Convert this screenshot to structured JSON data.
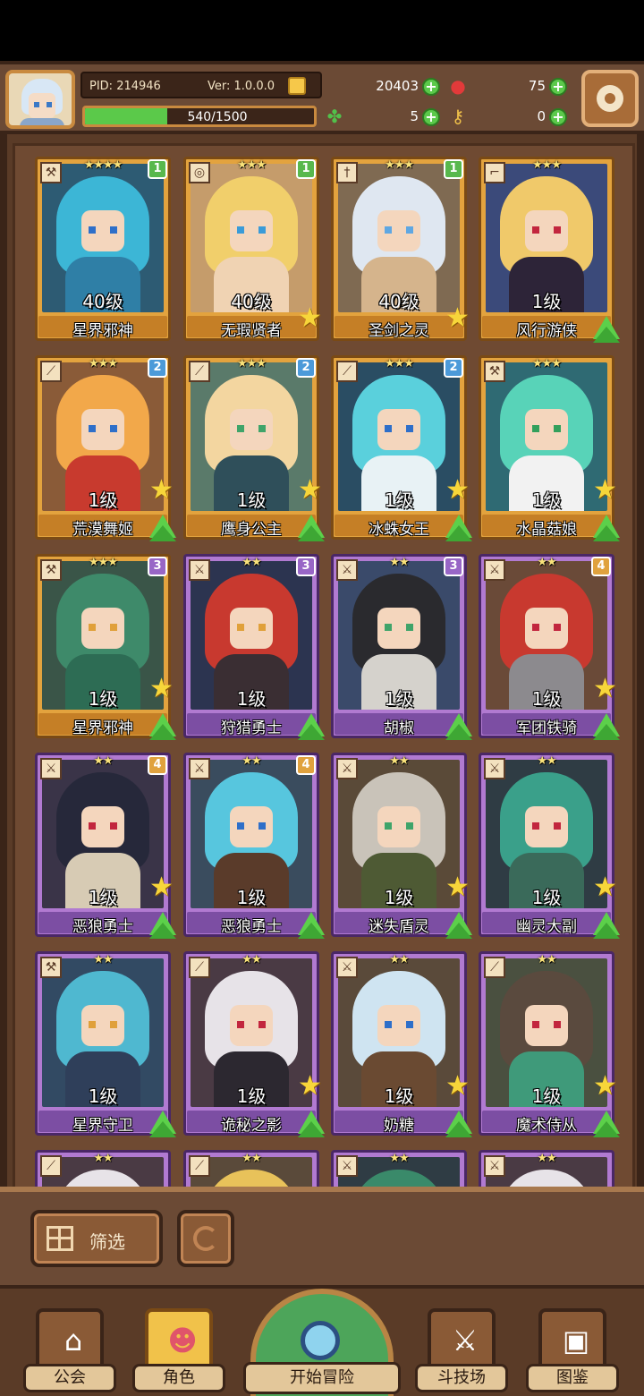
{
  "player": {
    "pid": "PID: 214946",
    "version": "Ver: 1.0.0.0",
    "xp_text": "540/1500",
    "xp_progress": 0.36
  },
  "resources": {
    "gold": "20403",
    "gems": "75",
    "clover": "5",
    "keys": "0"
  },
  "cards": [
    {
      "level": "40级",
      "name": "星界邪神",
      "stars": "★★★★",
      "rarity": "gold",
      "badge": "1",
      "badge_color": "green",
      "weapon": "wrench",
      "star_icon": false,
      "up": false,
      "hair": "#3cb6d6",
      "torso": "#2f7fa6",
      "eye": "#2e6fc9",
      "bg": "#2d5b73"
    },
    {
      "level": "40级",
      "name": "无瑕贤者",
      "stars": "★★★",
      "rarity": "gold",
      "badge": "1",
      "badge_color": "green",
      "weapon": "orb",
      "star_icon": true,
      "up": false,
      "hair": "#f1cf6b",
      "torso": "#f0d3b3",
      "eye": "#3a9bd8",
      "bg": "#c59c6b"
    },
    {
      "level": "40级",
      "name": "圣剑之灵",
      "stars": "★★★",
      "rarity": "gold",
      "badge": "1",
      "badge_color": "green",
      "weapon": "sword",
      "star_icon": true,
      "up": false,
      "hair": "#dfe7f1",
      "torso": "#d5b48c",
      "eye": "#5fa7e2",
      "bg": "#7f6a52"
    },
    {
      "level": "1级",
      "name": "风行游侠",
      "stars": "★★★",
      "rarity": "gold",
      "badge": "",
      "badge_color": "",
      "weapon": "gun",
      "star_icon": false,
      "up": true,
      "hair": "#f0c96a",
      "torso": "#2d2438",
      "eye": "#c2263e",
      "bg": "#3b4a7a"
    },
    {
      "level": "1级",
      "name": "荒漠舞姬",
      "stars": "★★★",
      "rarity": "gold",
      "badge": "2",
      "badge_color": "blue",
      "weapon": "blade",
      "star_icon": true,
      "up": true,
      "hair": "#f2a84a",
      "torso": "#c83a2e",
      "eye": "#2e6fc9",
      "bg": "#8a5b38"
    },
    {
      "level": "1级",
      "name": "鹰身公主",
      "stars": "★★★",
      "rarity": "gold",
      "badge": "2",
      "badge_color": "blue",
      "weapon": "blade",
      "star_icon": true,
      "up": true,
      "hair": "#f3d6a0",
      "torso": "#2f4f5a",
      "eye": "#3fa46a",
      "bg": "#5a7a6a"
    },
    {
      "level": "1级",
      "name": "冰蛛女王",
      "stars": "★★★",
      "rarity": "gold",
      "badge": "2",
      "badge_color": "blue",
      "weapon": "blade",
      "star_icon": true,
      "up": true,
      "hair": "#5ad0dc",
      "torso": "#e8f2f5",
      "eye": "#2e6fc9",
      "bg": "#2a4d63"
    },
    {
      "level": "1级",
      "name": "水晶菇娘",
      "stars": "★★★",
      "rarity": "gold",
      "badge": "",
      "badge_color": "",
      "weapon": "wrench",
      "star_icon": true,
      "up": true,
      "hair": "#58d3b8",
      "torso": "#f2f2f2",
      "eye": "#32a05c",
      "bg": "#2f6a73"
    },
    {
      "level": "1级",
      "name": "星界邪神",
      "stars": "★★★",
      "rarity": "gold",
      "badge": "3",
      "badge_color": "purple",
      "weapon": "wrench",
      "star_icon": true,
      "up": true,
      "hair": "#3e8a6a",
      "torso": "#2d6c54",
      "eye": "#e0a03a",
      "bg": "#3a5548"
    },
    {
      "level": "1级",
      "name": "狩猎勇士",
      "stars": "★★",
      "rarity": "purple",
      "badge": "3",
      "badge_color": "purple",
      "weapon": "axe",
      "star_icon": false,
      "up": true,
      "hair": "#c8392f",
      "torso": "#3a2e33",
      "eye": "#e0a03a",
      "bg": "#2c3450"
    },
    {
      "level": "1级",
      "name": "胡椒",
      "stars": "★★",
      "rarity": "purple",
      "badge": "3",
      "badge_color": "purple",
      "weapon": "axe",
      "star_icon": false,
      "up": true,
      "hair": "#2a2a2e",
      "torso": "#d5d2cc",
      "eye": "#3fa46a",
      "bg": "#3a4a6a"
    },
    {
      "level": "1级",
      "name": "军团铁骑",
      "stars": "★★",
      "rarity": "purple",
      "badge": "4",
      "badge_color": "orange",
      "weapon": "axe",
      "star_icon": true,
      "up": true,
      "hair": "#c8392f",
      "torso": "#8c8a8e",
      "eye": "#c2263e",
      "bg": "#6a4a38"
    },
    {
      "level": "1级",
      "name": "恶狼勇士",
      "stars": "★★",
      "rarity": "purple",
      "badge": "4",
      "badge_color": "orange",
      "weapon": "axe",
      "star_icon": true,
      "up": true,
      "hair": "#26283a",
      "torso": "#d7cbb4",
      "eye": "#c2263e",
      "bg": "#3a3448"
    },
    {
      "level": "1级",
      "name": "恶狼勇士",
      "stars": "★★",
      "rarity": "purple",
      "badge": "4",
      "badge_color": "orange",
      "weapon": "axe",
      "star_icon": false,
      "up": true,
      "hair": "#57c6de",
      "torso": "#5a3b2a",
      "eye": "#2e6fc9",
      "bg": "#3a4c5e"
    },
    {
      "level": "1级",
      "name": "迷失盾灵",
      "stars": "★★",
      "rarity": "purple",
      "badge": "",
      "badge_color": "",
      "weapon": "axe",
      "star_icon": true,
      "up": true,
      "hair": "#c9c3b9",
      "torso": "#4e5a34",
      "eye": "#3fa46a",
      "bg": "#5a4a38"
    },
    {
      "level": "1级",
      "name": "幽灵大副",
      "stars": "★★",
      "rarity": "purple",
      "badge": "",
      "badge_color": "",
      "weapon": "axe",
      "star_icon": true,
      "up": true,
      "hair": "#3aa08a",
      "torso": "#3a6a5a",
      "eye": "#c2263e",
      "bg": "#2f3c44"
    },
    {
      "level": "1级",
      "name": "星界守卫",
      "stars": "★★",
      "rarity": "purple",
      "badge": "",
      "badge_color": "",
      "weapon": "wrench",
      "star_icon": false,
      "up": true,
      "hair": "#4fb8d0",
      "torso": "#2f3f5a",
      "eye": "#e0a03a",
      "bg": "#324a63"
    },
    {
      "level": "1级",
      "name": "诡秘之影",
      "stars": "★★",
      "rarity": "purple",
      "badge": "",
      "badge_color": "",
      "weapon": "blade",
      "star_icon": true,
      "up": true,
      "hair": "#e7e3e8",
      "torso": "#2c2830",
      "eye": "#c2263e",
      "bg": "#4a3a44"
    },
    {
      "level": "1级",
      "name": "奶糖",
      "stars": "★★",
      "rarity": "purple",
      "badge": "",
      "badge_color": "",
      "weapon": "axe",
      "star_icon": true,
      "up": true,
      "hair": "#cfe4f1",
      "torso": "#6a4a32",
      "eye": "#2e6fc9",
      "bg": "#5a4a3a"
    },
    {
      "level": "1级",
      "name": "魔术侍从",
      "stars": "★★",
      "rarity": "purple",
      "badge": "",
      "badge_color": "",
      "weapon": "blade",
      "star_icon": true,
      "up": true,
      "hair": "#5a4a3e",
      "torso": "#3f9a7a",
      "eye": "#c2263e",
      "bg": "#4a5040"
    },
    {
      "level": "",
      "name": "",
      "stars": "★★",
      "rarity": "purple",
      "badge": "",
      "badge_color": "",
      "weapon": "blade",
      "star_icon": false,
      "up": false,
      "hair": "#e7e3e8",
      "torso": "#6a4a5a",
      "eye": "#c2263e",
      "bg": "#4a3a44"
    },
    {
      "level": "",
      "name": "",
      "stars": "★★",
      "rarity": "purple",
      "badge": "",
      "badge_color": "",
      "weapon": "blade",
      "star_icon": false,
      "up": false,
      "hair": "#e8c25a",
      "torso": "#6a4a32",
      "eye": "#2e6fc9",
      "bg": "#5a4a3a"
    },
    {
      "level": "",
      "name": "",
      "stars": "★★",
      "rarity": "purple",
      "badge": "",
      "badge_color": "",
      "weapon": "axe",
      "star_icon": false,
      "up": false,
      "hair": "#3a8a6a",
      "torso": "#c83a2e",
      "eye": "#e0a03a",
      "bg": "#2f3c44"
    },
    {
      "level": "",
      "name": "",
      "stars": "★★",
      "rarity": "purple",
      "badge": "",
      "badge_color": "",
      "weapon": "axe",
      "star_icon": false,
      "up": false,
      "hair": "#e7e3e8",
      "torso": "#6a4a5a",
      "eye": "#c2263e",
      "bg": "#4a3a44"
    }
  ],
  "filter": {
    "label": "筛选"
  },
  "nav": {
    "guild": "公会",
    "character": "角色",
    "adventure": "开始冒险",
    "arena": "斗技场",
    "codex": "图鉴"
  },
  "colors": {
    "frame_gold": "#e3a33e",
    "frame_purple": "#b17ad1",
    "xp_green": "#5bc94a",
    "panel_brown": "#6b4a35"
  },
  "icons": {
    "settings": "gear-icon",
    "gold": "coin-icon",
    "gems": "red-gem-icon",
    "clover": "clover-icon",
    "keys": "key-icon",
    "add": "plus-icon",
    "filter": "grid-filter-icon",
    "refresh": "refresh-icon"
  }
}
